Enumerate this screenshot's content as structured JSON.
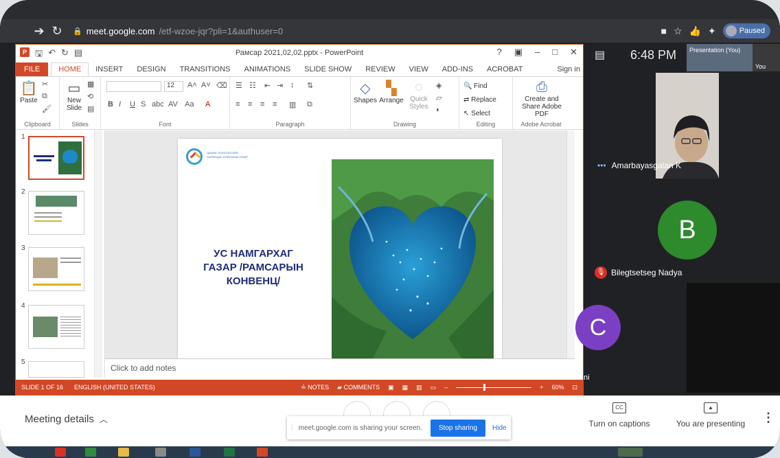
{
  "browser": {
    "url_host": "meet.google.com",
    "url_path": "/etf-wzoe-jqr?pli=1&authuser=0",
    "profile_status": "Paused"
  },
  "ppt": {
    "doc_title": "Рамсар 2021,02,02.pptx - PowerPoint",
    "tabs": [
      "FILE",
      "HOME",
      "INSERT",
      "DESIGN",
      "TRANSITIONS",
      "ANIMATIONS",
      "SLIDE SHOW",
      "REVIEW",
      "VIEW",
      "ADD-INS",
      "ACROBAT"
    ],
    "sign_in": "Sign in",
    "ribbon": {
      "paste": "Paste",
      "new_slide": "New Slide",
      "font_size": "12",
      "shapes": "Shapes",
      "arrange": "Arrange",
      "quick_styles": "Quick Styles",
      "find": "Find",
      "replace": "Replace",
      "select": "Select",
      "create_share": "Create and Share Adobe PDF",
      "groups": {
        "clipboard": "Clipboard",
        "slides": "Slides",
        "font": "Font",
        "paragraph": "Paragraph",
        "drawing": "Drawing",
        "editing": "Editing",
        "acrobat": "Adobe Acrobat"
      }
    },
    "thumb_numbers": [
      "1",
      "2",
      "3",
      "4",
      "5"
    ],
    "slide": {
      "org_line1": "ЦАХИМ ТЕХНОЛОГИЙН,",
      "org_line2": "ХАРИЛЦАА ХОЛБООНЫ ГАЗАР",
      "title": "УС НАМГАРХАГ ГАЗАР /РАМСАРЫН КОНВЕНЦ/"
    },
    "notes_placeholder": "Click to add notes",
    "status": {
      "slide_info": "SLIDE 1 OF 16",
      "language": "ENGLISH (UNITED STATES)",
      "notes": "NOTES",
      "comments": "COMMENTS",
      "zoom": "60%"
    }
  },
  "meet": {
    "time": "6:48 PM",
    "presentation_tile": "Presentation (You)",
    "you_label": "You",
    "participants": [
      {
        "name": "Amarbayasgalan K",
        "initial": ""
      },
      {
        "name": "Bilegtsetseg Nadya",
        "initial": "B"
      },
      {
        "name": "ni",
        "initial": "C"
      }
    ],
    "meeting_details": "Meeting details",
    "share_banner": "meet.google.com is sharing your screen.",
    "stop_sharing": "Stop sharing",
    "hide": "Hide",
    "captions": "Turn on captions",
    "presenting": "You are presenting",
    "colors": {
      "avatar_b": "#2d8a2d",
      "avatar_c": "#7b3fc4",
      "stop_button": "#1a73e8",
      "ppt_accent": "#d24726"
    }
  }
}
